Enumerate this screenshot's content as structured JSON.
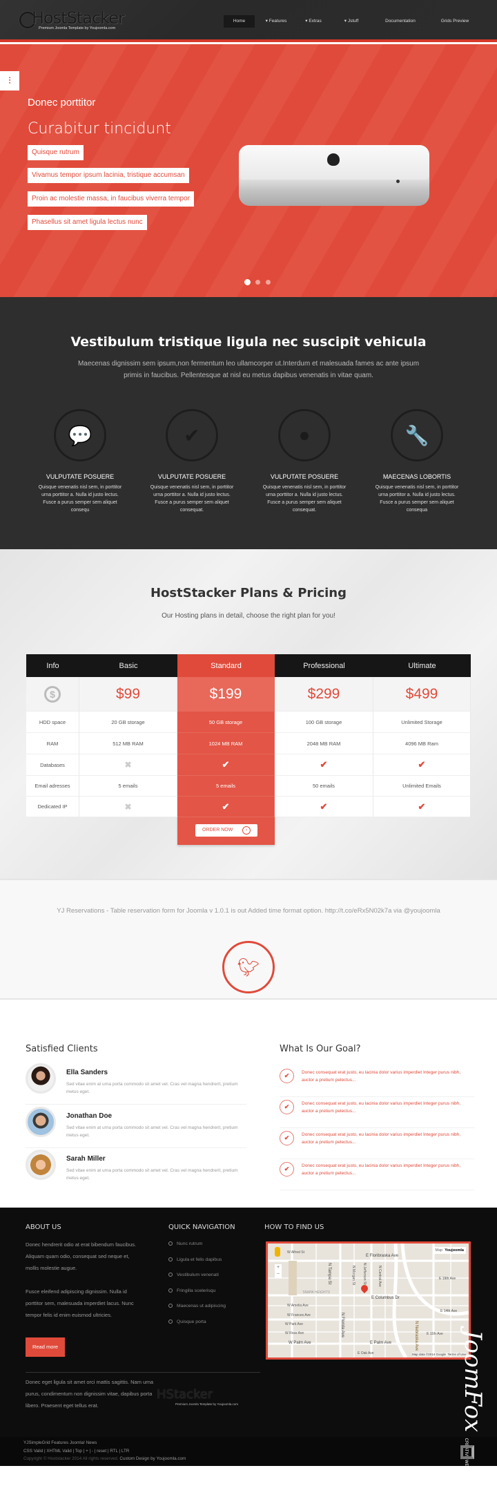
{
  "header": {
    "logo_text": "HostStacker",
    "logo_tagline": "Premium Joomla Template by Youjoomla.com",
    "nav": [
      {
        "label": "Home",
        "active": true,
        "dropdown": false
      },
      {
        "label": "Features",
        "dropdown": true
      },
      {
        "label": "Extras",
        "dropdown": true
      },
      {
        "label": "Jstuff",
        "dropdown": true
      },
      {
        "label": "Documentation",
        "dropdown": false
      },
      {
        "label": "Grids Preview",
        "dropdown": false
      }
    ]
  },
  "hero": {
    "side_icon": "sliders-icon",
    "subtitle": "Donec porttitor",
    "title": "Curabitur tincidunt",
    "bullets": [
      "Quisque rutrum",
      "Vivamus tempor ipsum lacinia, tristique accumsan",
      "Proin ac molestie massa, in faucibus viverra tempor",
      "Phasellus sit amet ligula lectus nunc"
    ],
    "slides": 3,
    "active_slide": 1,
    "accent": "#e04a3a"
  },
  "features": {
    "title": "Vestibulum tristique ligula nec suscipit vehicula",
    "description": "Maecenas dignissim sem ipsum,non fermentum leo ullamcorper ut.Interdum et malesuada fames ac ante ipsum primis in faucibus. Pellentesque at nisl eu metus dapibus venenatis in vitae quam.",
    "items": [
      {
        "icon": "chat-bubbles-icon",
        "title": "VULPUTATE POSUERE",
        "text": "Quisque venenatis nisl sem, in porttitor urna porttitor a. Nulla id justo lectus. Fusce a purus semper sem aliquet consequ"
      },
      {
        "icon": "checkmark-icon",
        "title": "VULPUTATE POSUERE",
        "text": "Quisque venenatis nisl sem, in porttitor urna porttitor a. Nulla id justo lectus. Fusce a purus semper sem aliquet consequat."
      },
      {
        "icon": "globe-icon",
        "title": "VULPUTATE POSUERE",
        "text": "Quisque venenatis nisl sem, in porttitor urna porttitor a. Nulla id justo lectus. Fusce a purus semper sem aliquet consequat."
      },
      {
        "icon": "wrench-icon",
        "title": "MAECENAS LOBORTIS",
        "text": "Quisque venenatis nisl sem, in porttitor urna porttitor a. Nulla id justo lectus. Fusce a purus semper sem aliquet consequa"
      }
    ]
  },
  "pricing": {
    "title": "HostStacker Plans & Pricing",
    "subtitle": "Our Hosting plans in detail, choose the right plan for you!",
    "info_label": "Info",
    "info_icon": "dollar-coin-icon",
    "row_labels": [
      "HDD space",
      "RAM",
      "Databases",
      "Email adresses",
      "Dedicated IP"
    ],
    "plans": [
      {
        "name": "Basic",
        "price": "$99",
        "hdd": "20 GB storage",
        "ram": "512 MB RAM",
        "databases": false,
        "email": "5 emails",
        "dedicated_ip": false
      },
      {
        "name": "Standard",
        "price": "$199",
        "hdd": "50 GB storage",
        "ram": "1024 MB RAM",
        "databases": true,
        "email": "5 emails",
        "dedicated_ip": true,
        "featured": true
      },
      {
        "name": "Professional",
        "price": "$299",
        "hdd": "100 GB storage",
        "ram": "2048 MB RAM",
        "databases": true,
        "email": "50 emails",
        "dedicated_ip": true
      },
      {
        "name": "Ultimate",
        "price": "$499",
        "hdd": "Unlimited Storage",
        "ram": "4096 MB Ram",
        "databases": true,
        "email": "Unlimited Emails",
        "dedicated_ip": true
      }
    ],
    "order_label": "ORDER NOW"
  },
  "twitter": {
    "tweet": "YJ Reservations - Table reservation form for Joomla v 1.0.1 is out Added time format option. http://t.co/eRx5N02k7a via @youjoomla",
    "icon": "twitter-bird-icon"
  },
  "clients": {
    "title": "Satisfied Clients",
    "items": [
      {
        "name": "Ella Sanders",
        "text": "Sed vitae enim at urna porta commodo sit amet vel. Cras vel magna hendrerit, pretium metus eget."
      },
      {
        "name": "Jonathan Doe",
        "text": "Sed vitae enim at urna porta commodo sit amet vel. Cras vel magna hendrerit, pretium metus eget."
      },
      {
        "name": "Sarah Miller",
        "text": "Sed vitae enim at urna porta commodo sit amet vel. Cras vel magna hendrerit, pretium metus eget."
      }
    ]
  },
  "goal": {
    "title": "What Is Our Goal?",
    "items": [
      "Donec consequat erat justo, eu lacinia dolor varius imperdiet Integer purus nibh, auctor a pretium pelectus...",
      "Donec consequat erat justo, eu lacinia dolor varius imperdiet Integer purus nibh, auctor a pretium pelectus...",
      "Donec consequat erat justo, eu lacinia dolor varius imperdiet Integer purus nibh, auctor a pretium pelectus...",
      "Donec consequat erat justo, eu lacinia dolor varius imperdiet Integer purus nibh, auctor a pretium pelectus..."
    ]
  },
  "footer": {
    "about_title": "ABOUT US",
    "about_p1": "Donec hendrerit odio at erat bibendum faucibus. Aliquam quam odio, consequat sed neque et, mollis molestie augue.",
    "about_p2": "Fusce eleifend adipiscing dignissim. Nulla id porttitor sem, malesuada imperdiet lacus. Nunc tempor felis id enim euismod ultricies.",
    "read_more": "Read more",
    "nav_title": "QUICK NAVIGATION",
    "nav_items": [
      "Nunc rutrum",
      "Ligula et felis dapibus",
      "Vestibulum venenati",
      "Fringilla scelerisqu",
      "Maecenas ut adipiscing",
      "Quisque porta"
    ],
    "map_title": "HOW TO FIND US",
    "map": {
      "map_btn": "Map",
      "map_owner": "Youjoomla",
      "labels": [
        "W Alfred St",
        "E Floribraska Ave",
        "TAMPA HEIGHTS",
        "E Columbus Dr",
        "W Amelia Ave",
        "W Frances Ave",
        "W Park Ave",
        "W Ross Ave",
        "W Palm Ave",
        "E Palm Ave",
        "E Oak Ave",
        "E 11th Ave",
        "E 14th Ave",
        "E 19th Ave",
        "N Tampa St",
        "N Florida Ave",
        "N Jefferson St",
        "N Nebraska Ave",
        "N Morgan St",
        "N Central Ave"
      ],
      "attribution": "Map data ©2014 Google",
      "terms": "Terms of Use"
    },
    "bottom_text": "Donec eget ligula sit amet orci mattis sagittis. Nam urna purus, condimentum non dignissim vitae, dapibus porta libero. Praesent eget tellus erat.",
    "logo_text": "HStacker",
    "logo_tagline": "Premium Joomla Template by Youjoomla.com"
  },
  "bottombar": {
    "links1": "YJSimpleGrid Features   Joomla! News",
    "links2": "CSS Valid | XHTML Valid | Top | + | - | reset | RTL | LTR",
    "copyright": "Copyright © Hoststacker 2014 All rights reserved.",
    "credit": "Custom Design by Youjoomla.com"
  },
  "watermark": {
    "text": "JoomFox",
    "tagline": "CREATIVE WEB STUDIO"
  }
}
